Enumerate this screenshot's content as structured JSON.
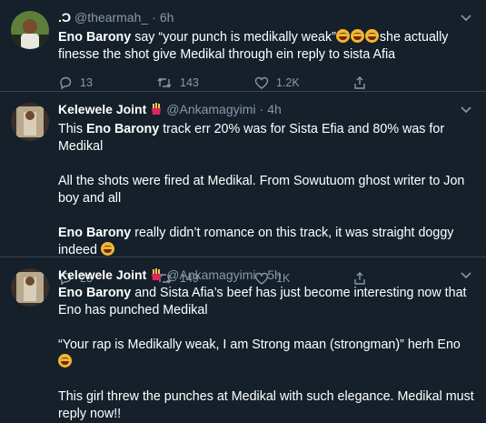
{
  "tweets": [
    {
      "name": ".Ɔ ",
      "handle": "@thearmah_",
      "time": "6h",
      "has_badge": false,
      "paragraphs": [
        [
          {
            "t": "Eno Barony",
            "b": true
          },
          {
            "t": " say “your punch is medikally weak”",
            "b": false
          },
          {
            "e": "joy"
          },
          {
            "e": "joy"
          },
          {
            "e": "joy"
          },
          {
            "t": "she actually finesse the shot give Medikal through ein reply to sista Afia",
            "b": false
          }
        ]
      ],
      "stats": {
        "replies": "13",
        "retweets": "143",
        "likes": "1.2K"
      }
    },
    {
      "name": "Kelewele Joint",
      "handle": "@Ankamagyimi",
      "time": "4h",
      "has_badge": true,
      "paragraphs": [
        [
          {
            "t": "This ",
            "b": false
          },
          {
            "t": "Eno Barony",
            "b": true
          },
          {
            "t": " track err 20% was for Sista Efia and 80% was for Medikal",
            "b": false
          }
        ],
        [
          {
            "t": "All the shots were fired at Medikal. From Sowutuom ghost writer to Jon boy and all",
            "b": false
          }
        ],
        [
          {
            "t": "Eno Barony",
            "b": true
          },
          {
            "t": " really didn’t romance on this track, it was straight doggy indeed",
            "b": false
          },
          {
            "t": " ",
            "b": false
          },
          {
            "e": "joy"
          }
        ]
      ],
      "stats": {
        "replies": "23",
        "retweets": "149",
        "likes": "1K"
      }
    },
    {
      "name": "Kelewele Joint",
      "handle": "@Ankamagyimi",
      "time": "5h",
      "has_badge": true,
      "paragraphs": [
        [
          {
            "t": "Eno Barony",
            "b": true
          },
          {
            "t": " and Sista Afia’s beef has just become interesting now that Eno has punched Medikal",
            "b": false
          }
        ],
        [
          {
            "t": "“Your rap is Medikally weak, I am Strong maan (strongman)” herh Eno ",
            "b": false
          },
          {
            "e": "joy"
          }
        ],
        [
          {
            "t": "This girl threw the punches at Medikal with such elegance. Medikal must reply now!!",
            "b": false
          }
        ]
      ],
      "stats": {
        "replies": "",
        "retweets": "",
        "likes": ""
      }
    }
  ],
  "colors": {
    "background": "#15202b",
    "muted": "#8899a6",
    "divider": "#38444d"
  },
  "icons": {
    "reply": "reply-icon",
    "retweet": "retweet-icon",
    "like": "heart-icon",
    "share": "share-icon",
    "more": "chevron-down-icon",
    "badge": "fries-emoji-icon"
  }
}
